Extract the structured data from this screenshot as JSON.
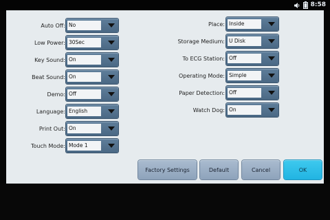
{
  "status": {
    "time": "8:58",
    "icons": [
      "volume-icon",
      "battery-icon"
    ]
  },
  "left_settings": [
    {
      "label": "Auto Off:",
      "value": "No"
    },
    {
      "label": "Low Power:",
      "value": "30Sec"
    },
    {
      "label": "Key Sound:",
      "value": "On"
    },
    {
      "label": "Beat Sound:",
      "value": "On"
    },
    {
      "label": "Demo:",
      "value": "Off"
    },
    {
      "label": "Language:",
      "value": "English"
    },
    {
      "label": "Print Out:",
      "value": "On"
    },
    {
      "label": "Touch Mode:",
      "value": "Mode 1"
    }
  ],
  "right_settings": [
    {
      "label": "Place:",
      "value": "Inside"
    },
    {
      "label": "Storage Medium:",
      "value": "U Disk"
    },
    {
      "label": "To ECG Station:",
      "value": "Off"
    },
    {
      "label": "Operating Mode:",
      "value": "Simple"
    },
    {
      "label": "Paper Detection:",
      "value": "Off"
    },
    {
      "label": "Watch Dog:",
      "value": "On"
    }
  ],
  "buttons": {
    "factory": "Factory Settings",
    "default": "Default",
    "cancel": "Cancel",
    "ok": "OK"
  },
  "colors": {
    "accent_ok": "#22b4e2",
    "select": "#4a6884",
    "panel": "#e6ebee"
  }
}
